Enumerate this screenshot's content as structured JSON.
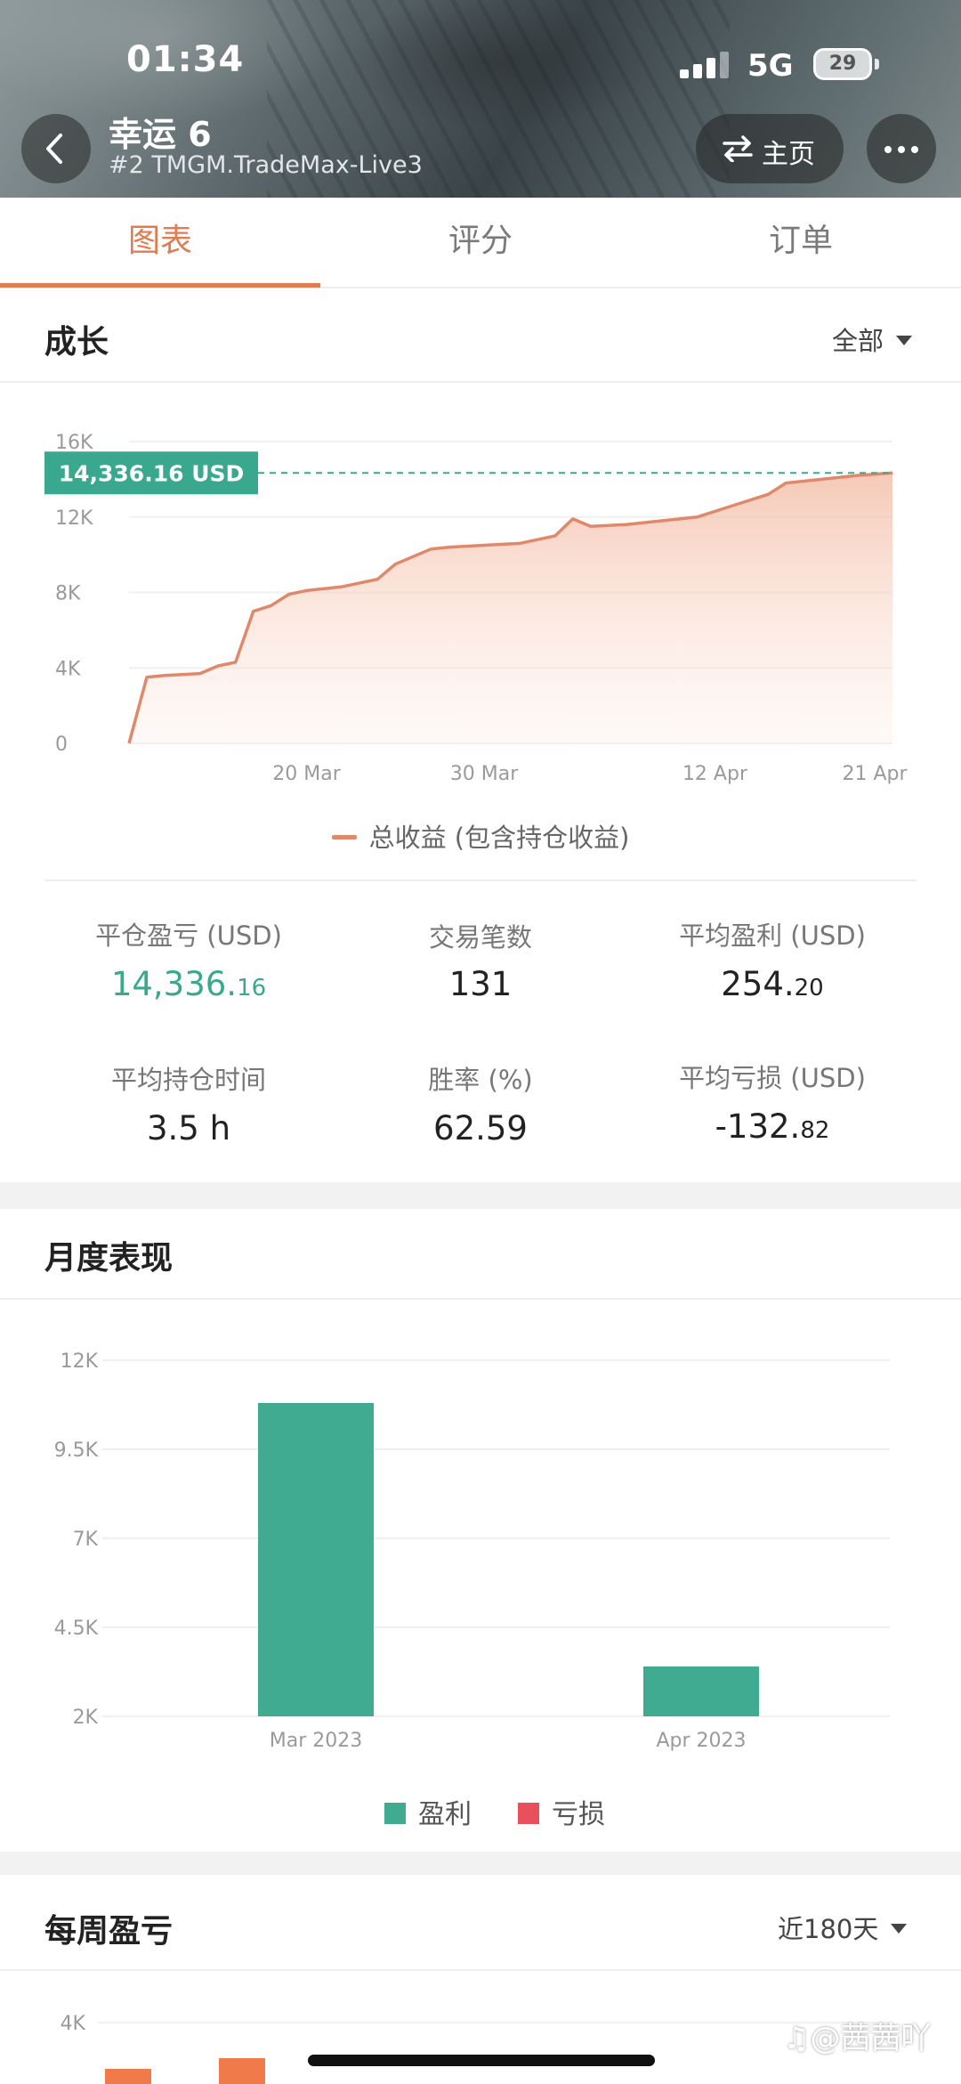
{
  "status_bar": {
    "time": "01:34",
    "network": "5G",
    "battery": "29"
  },
  "header": {
    "account_name": "幸运 6",
    "account_sub": "#2 TMGM.TradeMax-Live3",
    "home_button": "主页"
  },
  "tabs": [
    {
      "label": "图表",
      "active": true
    },
    {
      "label": "评分",
      "active": false
    },
    {
      "label": "订单",
      "active": false
    }
  ],
  "growth": {
    "title": "成长",
    "filter": "全部",
    "current_value_label": "14,336.16 USD",
    "legend": "总收益 (包含持仓收益)"
  },
  "stats": {
    "closed_pnl_label": "平仓盈亏 (USD)",
    "closed_pnl_int": "14,336.",
    "closed_pnl_dec": "16",
    "trades_label": "交易笔数",
    "trades_value": "131",
    "avg_profit_label": "平均盈利 (USD)",
    "avg_profit_int": "254.",
    "avg_profit_dec": "20",
    "avg_hold_label": "平均持仓时间",
    "avg_hold_value": "3.5 h",
    "win_rate_label": "胜率 (%)",
    "win_rate_value": "62.59",
    "avg_loss_label": "平均亏损 (USD)",
    "avg_loss_int": "-132.",
    "avg_loss_dec": "82"
  },
  "monthly": {
    "title": "月度表现",
    "legend_profit": "盈利",
    "legend_loss": "亏损"
  },
  "weekly": {
    "title": "每周盈亏",
    "filter": "近180天",
    "first_tick": "4K"
  },
  "watermark": "♫@茜茜吖",
  "colors": {
    "accent": "#e07c52",
    "line": "#e0896a",
    "profit": "#40ab90",
    "loss": "#e8505b",
    "value_tag": "#3aa88e"
  },
  "chart_data": [
    {
      "type": "area",
      "title": "",
      "series": [
        {
          "name": "总收益 (包含持仓收益)",
          "x": [
            "2023-03-10",
            "2023-03-11",
            "2023-03-12",
            "2023-03-13",
            "2023-03-14",
            "2023-03-15",
            "2023-03-16",
            "2023-03-17",
            "2023-03-18",
            "2023-03-19",
            "2023-03-20",
            "2023-03-22",
            "2023-03-24",
            "2023-03-25",
            "2023-03-27",
            "2023-03-28",
            "2023-03-30",
            "2023-04-01",
            "2023-04-03",
            "2023-04-04",
            "2023-04-05",
            "2023-04-07",
            "2023-04-09",
            "2023-04-11",
            "2023-04-13",
            "2023-04-15",
            "2023-04-16",
            "2023-04-18",
            "2023-04-20",
            "2023-04-22"
          ],
          "values": [
            0,
            3500,
            3600,
            3650,
            3700,
            4100,
            4300,
            7000,
            7300,
            7900,
            8100,
            8300,
            8700,
            9500,
            10300,
            10400,
            10500,
            10600,
            11000,
            11900,
            11500,
            11600,
            11800,
            12000,
            12600,
            13200,
            13800,
            14000,
            14200,
            14336.16
          ]
        }
      ],
      "xticks": [
        "20 Mar",
        "30 Mar",
        "12 Apr",
        "21 Apr"
      ],
      "yticks": [
        "0",
        "4K",
        "8K",
        "12K",
        "16K"
      ],
      "ylim": [
        0,
        16000
      ],
      "reference_value": 14336.16
    },
    {
      "type": "bar",
      "categories": [
        "Mar 2023",
        "Apr 2023"
      ],
      "series": [
        {
          "name": "盈利",
          "values": [
            10800,
            3400
          ]
        }
      ],
      "yticks": [
        "2K",
        "4.5K",
        "7K",
        "9.5K",
        "12K"
      ],
      "ylim": [
        2000,
        12000
      ]
    }
  ]
}
